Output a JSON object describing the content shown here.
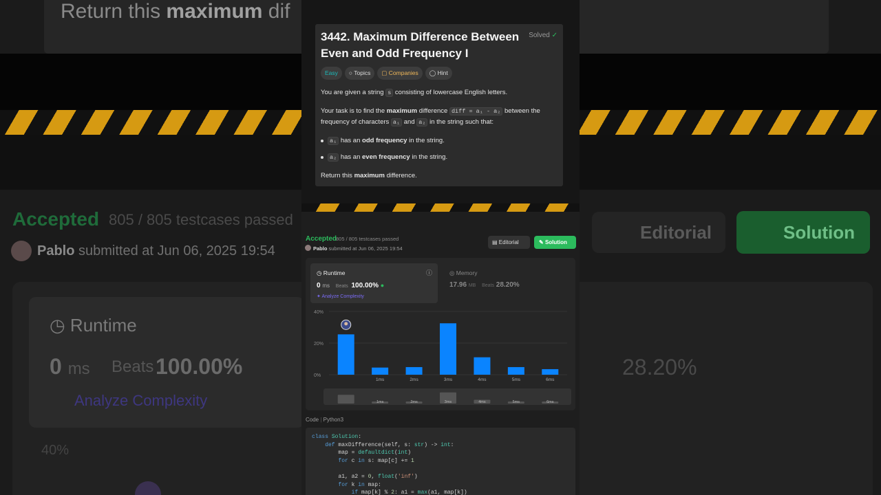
{
  "background": {
    "top_text_prefix": "Return this ",
    "top_text_bold": "maximum",
    "top_text_suffix": " dif",
    "accepted": "Accepted",
    "testcases": "805 / 805 testcases passed",
    "user": "Pablo",
    "submitted": "submitted at Jun 06, 2025 19:54",
    "editorial": "Editorial",
    "solution": "Solution",
    "runtime": "Runtime",
    "runtime_value": "0",
    "runtime_unit": "ms",
    "beats": "Beats",
    "beats_pct": "100.00%",
    "analyze": "Analyze Complexity",
    "memory_pct": "28.20%",
    "axis_top": "40%"
  },
  "problem": {
    "title": "3442. Maximum Difference Between Even and Odd Frequency I",
    "status": "Solved",
    "tags": [
      {
        "label": "Easy"
      },
      {
        "label": "Topics",
        "icon": "tag-icon"
      },
      {
        "label": "Companies",
        "icon": "lock-icon"
      },
      {
        "label": "Hint",
        "icon": "lightbulb-icon"
      }
    ],
    "p1_a": "You are given a string ",
    "p1_code": "s",
    "p1_b": " consisting of lowercase English letters.",
    "p2_a": "Your task is to find the ",
    "p2_bold": "maximum",
    "p2_b": " difference ",
    "p2_code": "diff = a₁ - a₂",
    "p2_c": " between the frequency of characters ",
    "p2_code2": "a₁",
    "p2_d": " and ",
    "p2_code3": "a₂",
    "p2_e": " in the string such that:",
    "li1_code": "a₁",
    "li1_a": " has an ",
    "li1_bold": "odd frequency",
    "li1_b": " in the string.",
    "li2_code": "a₂",
    "li2_a": " has an ",
    "li2_bold": "even frequency",
    "li2_b": " in the string.",
    "p3_a": "Return this ",
    "p3_bold": "maximum",
    "p3_b": " difference."
  },
  "submission": {
    "accepted": "Accepted",
    "testcases": "805 / 805 testcases passed",
    "user": "Pablo",
    "submitted": "submitted at Jun 06, 2025 19:54",
    "editorial_btn": "Editorial",
    "solution_btn": "Solution",
    "runtime_label": "Runtime",
    "runtime_value": "0",
    "runtime_unit": "ms",
    "beats_label": "Beats",
    "runtime_beats": "100.00%",
    "analyze": "Analyze Complexity",
    "memory_label": "Memory",
    "memory_value": "17.96",
    "memory_unit": "MB",
    "memory_beats": "28.20%"
  },
  "code": {
    "label": "Code",
    "lang": "Python3",
    "lines": [
      "class Solution:",
      "    def maxDifference(self, s: str) -> int:",
      "        map = defaultdict(int)",
      "        for c in s: map[c] += 1",
      "",
      "        a1, a2 = 0, float('inf')",
      "        for k in map:",
      "            if map[k] % 2: a1 = max(a1, map[k])"
    ]
  },
  "chart_data": {
    "type": "bar",
    "categories": [
      "0ms",
      "1ms",
      "2ms",
      "3ms",
      "4ms",
      "5ms",
      "6ms"
    ],
    "tick_labels": [
      "",
      "1ms",
      "2ms",
      "3ms",
      "4ms",
      "5ms",
      "6ms"
    ],
    "values": [
      25.5,
      4.5,
      4.8,
      32.5,
      11,
      4.8,
      3.5
    ],
    "yticks": [
      "0%",
      "20%",
      "40%"
    ],
    "ylim": [
      0,
      40
    ],
    "highlight_index": 0,
    "bar_color": "#0a84ff",
    "marker_icon": "user-avatar-icon"
  },
  "colors": {
    "accent_green": "#2cbb5d",
    "bar_blue": "#0a84ff",
    "easy_teal": "#1cbaba",
    "companies_orange": "#f0b85a",
    "analyze_purple": "#7b6cf6"
  }
}
